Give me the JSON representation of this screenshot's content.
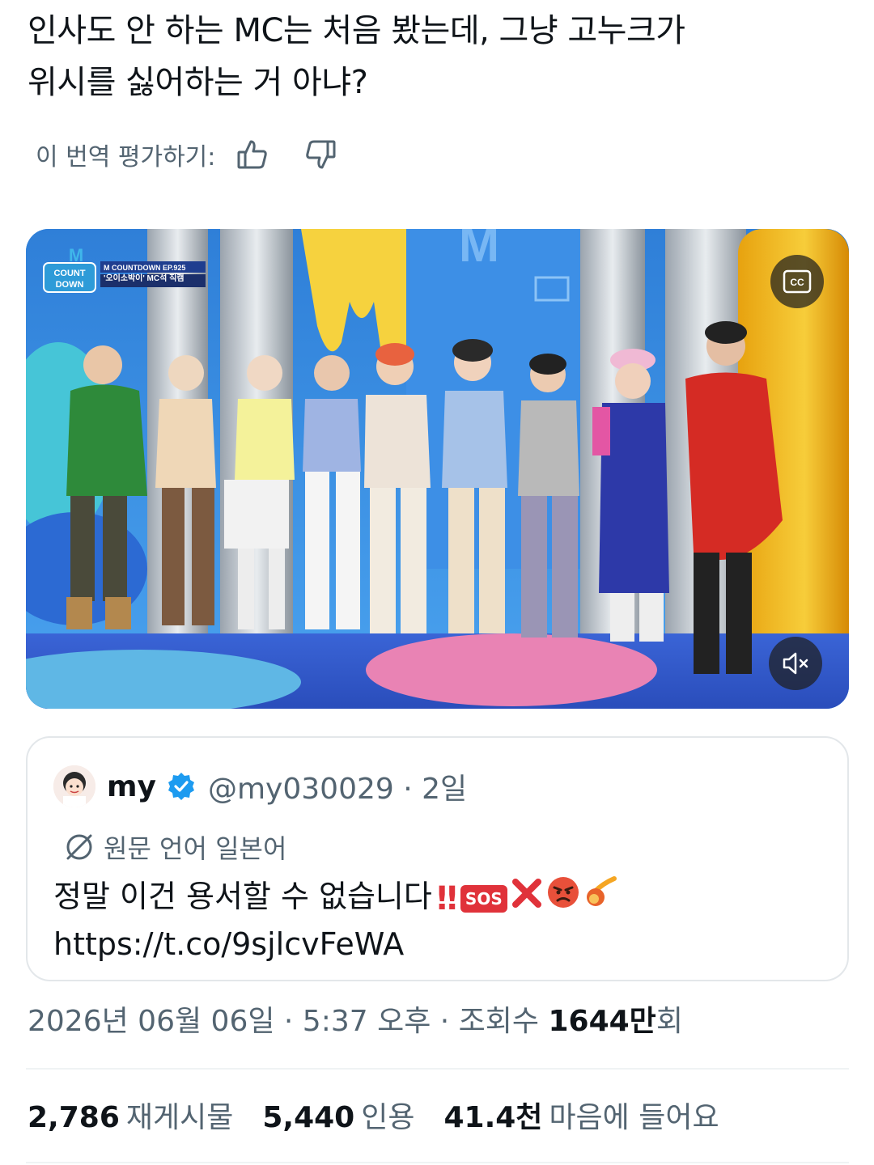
{
  "tweet": {
    "text_line1": "인사도 안 하는 MC는 처음 봤는데, 그냥 고누크가",
    "text_line2": "위시를 싫어하는 거 아냐?"
  },
  "translation_rating": {
    "label": "이 번역 평가하기:",
    "thumbs_up_icon": "thumbs-up-icon",
    "thumbs_down_icon": "thumbs-down-icon"
  },
  "video": {
    "logo_text": "COUNT DOWN",
    "caption_line1": "M COUNTDOWN EP.925",
    "caption_line2": "'오이소박이' MC석 직캠",
    "cc_label": "CC",
    "mute_icon": "mute-icon"
  },
  "quoted_tweet": {
    "name": "my",
    "handle_and_time": "@my030029 · 2일",
    "translate_note": "원문 언어 일본어",
    "body": "정말 이건 용서할 수 없습니다",
    "link": "https://t.co/9sjlcvFeWA",
    "emojis": [
      "‼",
      "🆘",
      "❌",
      "😡",
      "☄"
    ]
  },
  "meta": {
    "date_time": "2026년 06월 06일 · 5:37 오후 · 조회수 ",
    "views_num": "1644만",
    "views_suffix": "회"
  },
  "stats": {
    "reposts_num": "2,786",
    "reposts_label": "재게시물",
    "quotes_num": "5,440",
    "quotes_label": "인용",
    "likes_num": "41.4천",
    "likes_label": "마음에 들어요"
  },
  "colors": {
    "text_primary": "#0f1419",
    "text_secondary": "#536471",
    "verified_blue": "#1d9bf0",
    "border": "#e3e7ea"
  }
}
